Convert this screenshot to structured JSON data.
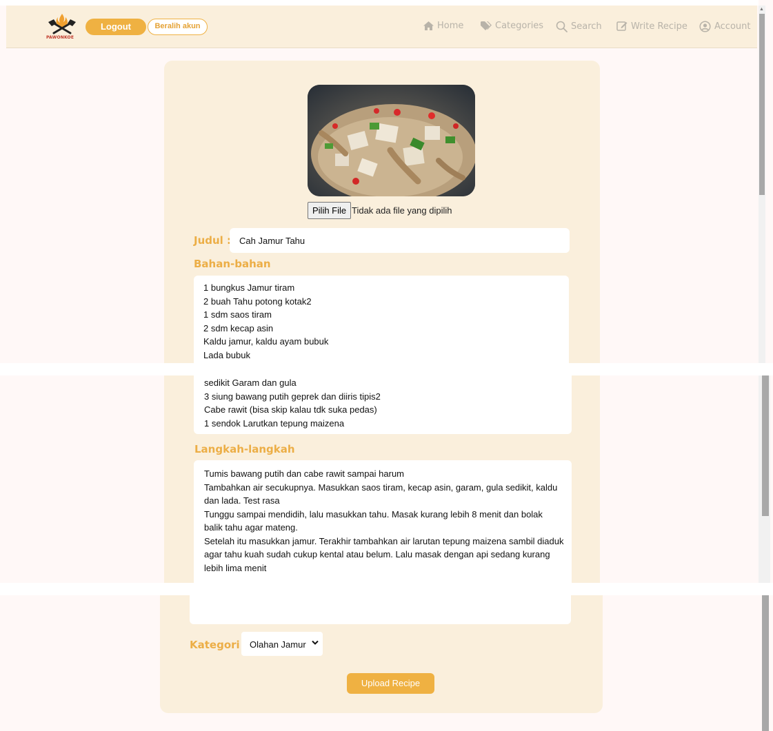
{
  "header": {
    "logo_text": "PAWONKOE",
    "logout_label": "Logout",
    "switch_account_label": "Beralih akun",
    "nav": [
      {
        "label": "Home",
        "icon": "home-icon"
      },
      {
        "label": "Categories",
        "icon": "tag-icon"
      },
      {
        "label": "Search",
        "icon": "search-icon"
      },
      {
        "label": "Write Recipe",
        "icon": "edit-icon"
      },
      {
        "label": "Account",
        "icon": "user-circle-icon"
      }
    ]
  },
  "form": {
    "file_button_label": "Pilih File",
    "file_status": "Tidak ada file yang dipilih",
    "title_label": "Judul :",
    "title_value": "Cah Jamur Tahu",
    "ingredients_label": "Bahan-bahan",
    "ingredients": [
      "1 bungkus Jamur tiram",
      "2 buah Tahu potong kotak2",
      "1 sdm saos tiram",
      "2 sdm kecap asin",
      "Kaldu jamur, kaldu ayam bubuk",
      "Lada bubuk",
      "sedikit Garam dan gula",
      "3 siung bawang putih geprek dan diiris tipis2",
      "Cabe rawit (bisa skip kalau tdk suka pedas)",
      "1 sendok Larutkan tepung maizena"
    ],
    "steps_label": "Langkah-langkah",
    "steps": [
      "Tumis bawang putih dan cabe rawit sampai harum",
      "Tambahkan air secukupnya. Masukkan saos tiram, kecap asin, garam, gula sedikit, kaldu",
      "dan lada. Test rasa",
      "Tunggu sampai mendidih, lalu masukkan tahu. Masak kurang lebih 8 menit dan bolak",
      "balik tahu agar mateng.",
      "Setelah itu masukkan jamur. Terakhir tambahkan air larutan tepung maizena sambil diaduk",
      "agar tahu kuah sudah cukup kental atau belum. Lalu masak dengan api sedang kurang",
      "lebih lima menit"
    ],
    "category_label": "Kategori :",
    "category_value": "Olahan Jamur",
    "upload_label": "Upload Recipe"
  },
  "colors": {
    "accent": "#efb142",
    "header_bg": "#faefdc",
    "page_bg": "#fff8f7",
    "card_bg": "#faefdc"
  }
}
